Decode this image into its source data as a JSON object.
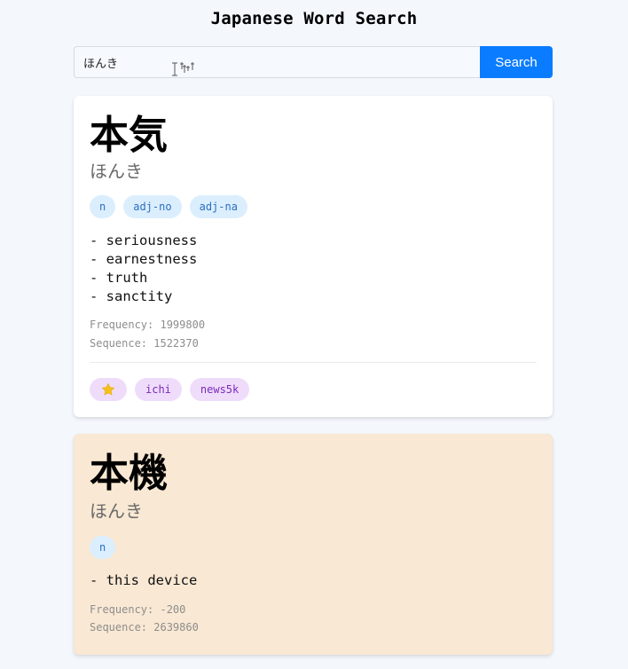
{
  "app": {
    "title": "Japanese Word Search"
  },
  "search": {
    "value": "ほんき",
    "button_label": "Search"
  },
  "results": [
    {
      "kanji": "本気",
      "reading": "ほんき",
      "pos_tags": [
        "n",
        "adj-no",
        "adj-na"
      ],
      "senses": [
        "- seriousness",
        "- earnestness",
        "- truth",
        "- sanctity"
      ],
      "frequency": "Frequency: 1999800",
      "sequence": "Sequence: 1522370",
      "badges": [
        {
          "icon": "star-icon",
          "color": "#f6c01a"
        },
        {
          "label": "ichi"
        },
        {
          "label": "news5k"
        }
      ],
      "background": "#ffffff"
    },
    {
      "kanji": "本機",
      "reading": "ほんき",
      "pos_tags": [
        "n"
      ],
      "senses": [
        "- this device"
      ],
      "frequency": "Frequency: -200",
      "sequence": "Sequence: 2639860",
      "background": "#f9e8d3"
    }
  ],
  "colors": {
    "accent": "#0a7cff",
    "pos_tag_bg": "#dbeefe",
    "pos_tag_text": "#2b6fbf",
    "badge_bg": "#efdcfb",
    "badge_text": "#7a2ab8",
    "page_bg": "#f4f8fd"
  }
}
